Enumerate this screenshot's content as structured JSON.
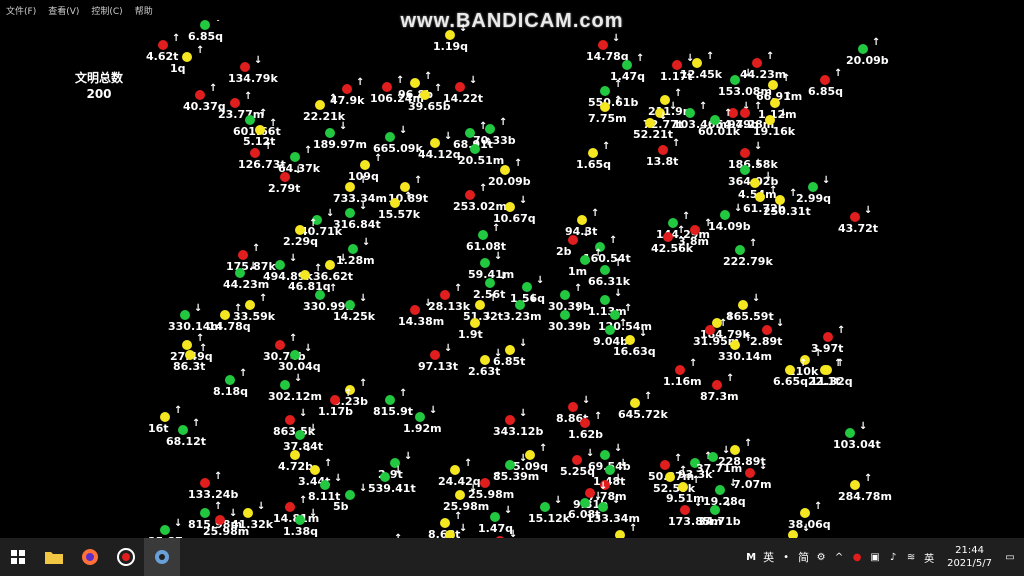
{
  "menu": [
    "文件(F)",
    "查看(V)",
    "控制(C)",
    "帮助"
  ],
  "watermark": "www.BANDICAM.com",
  "total": {
    "label": "文明总数",
    "value": "200"
  },
  "units": [
    {
      "c": "green",
      "v": "6.85q",
      "a": "↓"
    },
    {
      "c": "red",
      "v": "4.62t",
      "a": "↑"
    },
    {
      "c": "yellow",
      "v": "1q",
      "a": "↑"
    },
    {
      "c": "red",
      "v": "134.79k",
      "a": "↓"
    },
    {
      "c": "red",
      "v": "40.37q",
      "a": "↑"
    },
    {
      "c": "red",
      "v": "23.77m",
      "a": "↑"
    },
    {
      "c": "green",
      "v": "601.66t",
      "a": "↑"
    },
    {
      "c": "yellow",
      "v": "5.12t",
      "a": "↑"
    },
    {
      "c": "red",
      "v": "126.73t",
      "a": "↑"
    },
    {
      "c": "green",
      "v": "64.37k",
      "a": "↑"
    },
    {
      "c": "red",
      "v": "2.79t",
      "a": "↓"
    },
    {
      "c": "yellow",
      "v": "22.21k",
      "a": "↑"
    },
    {
      "c": "red",
      "v": "47.9k",
      "a": "↑"
    },
    {
      "c": "red",
      "v": "106.24m",
      "a": "↑"
    },
    {
      "c": "yellow",
      "v": "96.8b",
      "a": "↑"
    },
    {
      "c": "yellow",
      "v": "39.65b",
      "a": "↑"
    },
    {
      "c": "red",
      "v": "14.22t",
      "a": "↓"
    },
    {
      "c": "yellow",
      "v": "1.19q",
      "a": "↓"
    },
    {
      "c": "green",
      "v": "189.97m",
      "a": "↓"
    },
    {
      "c": "green",
      "v": "665.09k",
      "a": "↓"
    },
    {
      "c": "yellow",
      "v": "44.12q",
      "a": "↓"
    },
    {
      "c": "green",
      "v": "68.91t",
      "a": "↑"
    },
    {
      "c": "green",
      "v": "70.33b",
      "a": "↑"
    },
    {
      "c": "green",
      "v": "20.51m",
      "a": "↑"
    },
    {
      "c": "yellow",
      "v": "109q",
      "a": "↑"
    },
    {
      "c": "yellow",
      "v": "733.34m",
      "a": "↑"
    },
    {
      "c": "yellow",
      "v": "10.89t",
      "a": "↑"
    },
    {
      "c": "yellow",
      "v": "15.57k",
      "a": "↑"
    },
    {
      "c": "yellow",
      "v": "20.09b",
      "a": "↑"
    },
    {
      "c": "red",
      "v": "253.02m",
      "a": "↑"
    },
    {
      "c": "yellow",
      "v": "10.67q",
      "a": "↓"
    },
    {
      "c": "green",
      "v": "316.84t",
      "a": "↓"
    },
    {
      "c": "green",
      "v": "40.71k",
      "a": "↓"
    },
    {
      "c": "yellow",
      "v": "2.29q",
      "a": "↑"
    },
    {
      "c": "green",
      "v": "61.08t",
      "a": "↑"
    },
    {
      "c": "green",
      "v": "1.28m",
      "a": "↓"
    },
    {
      "c": "red",
      "v": "175.87k",
      "a": "↑"
    },
    {
      "c": "green",
      "v": "44.23m",
      "a": "↓"
    },
    {
      "c": "green",
      "v": "494.89k",
      "a": "↓"
    },
    {
      "c": "yellow",
      "v": "46.81q",
      "a": "↑"
    },
    {
      "c": "yellow",
      "v": "36.62t",
      "a": "↓"
    },
    {
      "c": "green",
      "v": "59.41m",
      "a": "↓"
    },
    {
      "c": "green",
      "v": "2.56t",
      "a": "↓"
    },
    {
      "c": "green",
      "v": "1.56q",
      "a": "↓"
    },
    {
      "c": "green",
      "v": "30.39b",
      "a": "↑"
    },
    {
      "c": "green",
      "v": "330.99k",
      "a": "↑"
    },
    {
      "c": "green",
      "v": "14.25k",
      "a": "↓"
    },
    {
      "c": "red",
      "v": "28.13k",
      "a": "↑"
    },
    {
      "c": "red",
      "v": "14.38m",
      "a": "↓"
    },
    {
      "c": "yellow",
      "v": "51.32t",
      "a": "↑"
    },
    {
      "c": "green",
      "v": "3.23m",
      "a": "↓"
    },
    {
      "c": "yellow",
      "v": "1.9t",
      "a": "↓"
    },
    {
      "c": "green",
      "v": "30.39b",
      "a": "↓"
    },
    {
      "c": "green",
      "v": "330.14m",
      "a": "↓"
    },
    {
      "c": "yellow",
      "v": "33.59k",
      "a": "↑"
    },
    {
      "c": "yellow",
      "v": "14.78q",
      "a": "↑"
    },
    {
      "c": "yellow",
      "v": "27.49q",
      "a": "↑"
    },
    {
      "c": "yellow",
      "v": "86.3t",
      "a": "↑"
    },
    {
      "c": "red",
      "v": "30.74b",
      "a": "↑"
    },
    {
      "c": "green",
      "v": "30.04q",
      "a": "↓"
    },
    {
      "c": "red",
      "v": "97.13t",
      "a": "↓"
    },
    {
      "c": "yellow",
      "v": "2.63t",
      "a": "↓"
    },
    {
      "c": "yellow",
      "v": "6.85t",
      "a": "↓"
    },
    {
      "c": "green",
      "v": "8.18q",
      "a": "↑"
    },
    {
      "c": "green",
      "v": "302.12m",
      "a": "↓"
    },
    {
      "c": "yellow",
      "v": "3.23b",
      "a": "↑"
    },
    {
      "c": "red",
      "v": "1.17b",
      "a": "↑"
    },
    {
      "c": "green",
      "v": "815.9t",
      "a": "↑"
    },
    {
      "c": "green",
      "v": "1.92m",
      "a": "↓"
    },
    {
      "c": "yellow",
      "v": "16t",
      "a": "↑"
    },
    {
      "c": "green",
      "v": "68.12t",
      "a": "↑"
    },
    {
      "c": "red",
      "v": "863.5k",
      "a": "↓"
    },
    {
      "c": "green",
      "v": "37.84t",
      "a": "↓"
    },
    {
      "c": "red",
      "v": "343.12b",
      "a": "↓"
    },
    {
      "c": "yellow",
      "v": "5.09q",
      "a": "↑"
    },
    {
      "c": "yellow",
      "v": "4.72b",
      "a": "↓"
    },
    {
      "c": "yellow",
      "v": "3.44t",
      "a": "↑"
    },
    {
      "c": "green",
      "v": "2.9t",
      "a": "↓"
    },
    {
      "c": "green",
      "v": "539.41t",
      "a": "↓"
    },
    {
      "c": "yellow",
      "v": "24.42q",
      "a": "↑"
    },
    {
      "c": "red",
      "v": "25.98m",
      "a": "↑"
    },
    {
      "c": "green",
      "v": "85.39m",
      "a": "↓"
    },
    {
      "c": "yellow",
      "v": "25.98m",
      "a": "↓"
    },
    {
      "c": "red",
      "v": "133.24b",
      "a": "↑"
    },
    {
      "c": "green",
      "v": "8.11t",
      "a": "↓"
    },
    {
      "c": "green",
      "v": "5b",
      "a": "↓"
    },
    {
      "c": "yellow",
      "v": "41.32k",
      "a": "↓"
    },
    {
      "c": "red",
      "v": "14.81m",
      "a": "↑"
    },
    {
      "c": "green",
      "v": "1.38q",
      "a": "↓"
    },
    {
      "c": "green",
      "v": "815.98m",
      "a": "↑"
    },
    {
      "c": "red",
      "v": "25.98m",
      "a": "↓"
    },
    {
      "c": "green",
      "v": "35.87q",
      "a": "↓"
    },
    {
      "c": "yellow",
      "v": "8.68t",
      "a": "↑"
    },
    {
      "c": "yellow",
      "v": "7.13q",
      "a": "↓"
    },
    {
      "c": "green",
      "v": "1.47q",
      "a": "↓"
    },
    {
      "c": "red",
      "v": "46.81q",
      "a": "↑"
    },
    {
      "c": "red",
      "v": "70.38t",
      "a": "↓"
    },
    {
      "c": "green",
      "v": "15.12k",
      "a": "↓"
    },
    {
      "c": "red",
      "v": "17.61m",
      "a": "↑"
    },
    {
      "c": "red",
      "v": "14.78q",
      "a": "↓"
    },
    {
      "c": "green",
      "v": "1.47q",
      "a": "↑"
    },
    {
      "c": "red",
      "v": "1.17t",
      "a": "↓"
    },
    {
      "c": "yellow",
      "v": "12.45k",
      "a": "↑"
    },
    {
      "c": "red",
      "v": "44.23m",
      "a": "↑"
    },
    {
      "c": "green",
      "v": "550.61b",
      "a": "↑"
    },
    {
      "c": "yellow",
      "v": "7.75m",
      "a": "↑"
    },
    {
      "c": "green",
      "v": "153.08m",
      "a": "↓"
    },
    {
      "c": "yellow",
      "v": "66.91m",
      "a": "↑"
    },
    {
      "c": "red",
      "v": "6.85q",
      "a": "↑"
    },
    {
      "c": "green",
      "v": "20.09b",
      "a": "↑"
    },
    {
      "c": "yellow",
      "v": "1.12m",
      "a": "↑"
    },
    {
      "c": "yellow",
      "v": "211.9m",
      "a": "↑"
    },
    {
      "c": "yellow",
      "v": "72.77t",
      "a": "↓"
    },
    {
      "c": "green",
      "v": "103.46m",
      "a": "↑"
    },
    {
      "c": "red",
      "v": "54.79b",
      "a": "↓"
    },
    {
      "c": "red",
      "v": "94.28m",
      "a": "↑"
    },
    {
      "c": "green",
      "v": "60.01k",
      "a": "↑"
    },
    {
      "c": "yellow",
      "v": "52.21t",
      "a": "↓"
    },
    {
      "c": "yellow",
      "v": "19.16k",
      "a": "↓"
    },
    {
      "c": "yellow",
      "v": "1.65q",
      "a": "↑"
    },
    {
      "c": "red",
      "v": "13.8t",
      "a": "↑"
    },
    {
      "c": "red",
      "v": "186.58k",
      "a": "↓"
    },
    {
      "c": "green",
      "v": "364.02b",
      "a": "↓"
    },
    {
      "c": "yellow",
      "v": "4.54m",
      "a": "↓"
    },
    {
      "c": "yellow",
      "v": "61.72b",
      "a": "↑"
    },
    {
      "c": "yellow",
      "v": "250.31t",
      "a": "↑"
    },
    {
      "c": "green",
      "v": "2.99q",
      "a": "↓"
    },
    {
      "c": "red",
      "v": "43.72t",
      "a": "↓"
    },
    {
      "c": "yellow",
      "v": "94.3t",
      "a": "↑"
    },
    {
      "c": "red",
      "v": "2b",
      "a": "↓"
    },
    {
      "c": "green",
      "v": "160.54t",
      "a": "↑"
    },
    {
      "c": "green",
      "v": "1m",
      "a": "↑"
    },
    {
      "c": "green",
      "v": "66.31k",
      "a": "↑"
    },
    {
      "c": "green",
      "v": "144.29m",
      "a": "↑"
    },
    {
      "c": "red",
      "v": "42.56k",
      "a": "↑"
    },
    {
      "c": "red",
      "v": "3.8m",
      "a": "↑"
    },
    {
      "c": "green",
      "v": "14.09b",
      "a": "↓"
    },
    {
      "c": "green",
      "v": "222.79k",
      "a": "↑"
    },
    {
      "c": "green",
      "v": "1.13m",
      "a": "↓"
    },
    {
      "c": "green",
      "v": "120.54m",
      "a": "↑"
    },
    {
      "c": "green",
      "v": "9.04b",
      "a": "↑"
    },
    {
      "c": "yellow",
      "v": "16.63q",
      "a": "↓"
    },
    {
      "c": "yellow",
      "v": "865.59t",
      "a": "↓"
    },
    {
      "c": "yellow",
      "v": "184.79k",
      "a": "↑"
    },
    {
      "c": "red",
      "v": "31.95m",
      "a": "↑"
    },
    {
      "c": "red",
      "v": "2.89t",
      "a": "↓"
    },
    {
      "c": "yellow",
      "v": "330.14m",
      "a": "↑"
    },
    {
      "c": "red",
      "v": "3.97t",
      "a": "↑"
    },
    {
      "c": "yellow",
      "v": "210k",
      "a": "↑"
    },
    {
      "c": "yellow",
      "v": "22.1t",
      "a": "↑"
    },
    {
      "c": "red",
      "v": "1.16m",
      "a": "↑"
    },
    {
      "c": "red",
      "v": "87.3m",
      "a": "↑"
    },
    {
      "c": "yellow",
      "v": "6.65q",
      "a": "↑"
    },
    {
      "c": "yellow",
      "v": "11.32q",
      "a": "↑"
    },
    {
      "c": "yellow",
      "v": "645.72k",
      "a": "↑"
    },
    {
      "c": "red",
      "v": "8.86t",
      "a": "↓"
    },
    {
      "c": "red",
      "v": "1.62b",
      "a": "↑"
    },
    {
      "c": "green",
      "v": "103.04t",
      "a": "↓"
    },
    {
      "c": "green",
      "v": "69.54b",
      "a": "↓"
    },
    {
      "c": "red",
      "v": "5.25q",
      "a": "↓"
    },
    {
      "c": "green",
      "v": "1.48t",
      "a": "↓"
    },
    {
      "c": "red",
      "v": "7.78m",
      "a": "↓"
    },
    {
      "c": "red",
      "v": "9.31b",
      "a": "↓"
    },
    {
      "c": "green",
      "v": "6.08t",
      "a": "↓"
    },
    {
      "c": "green",
      "v": "133.34m",
      "a": "↓"
    },
    {
      "c": "red",
      "v": "50.27m",
      "a": "↑"
    },
    {
      "c": "yellow",
      "v": "52.59k",
      "a": "↑"
    },
    {
      "c": "green",
      "v": "93.3k",
      "a": "↑"
    },
    {
      "c": "yellow",
      "v": "228.89t",
      "a": "↑"
    },
    {
      "c": "green",
      "v": "37.71m",
      "a": "↓"
    },
    {
      "c": "red",
      "v": "7.07m",
      "a": "↓"
    },
    {
      "c": "yellow",
      "v": "9.51m",
      "a": "↑"
    },
    {
      "c": "green",
      "v": "19.28q",
      "a": "↓"
    },
    {
      "c": "yellow",
      "v": "284.78m",
      "a": "↑"
    },
    {
      "c": "red",
      "v": "173.85m",
      "a": "↓"
    },
    {
      "c": "green",
      "v": "34.71b",
      "a": "↓"
    },
    {
      "c": "yellow",
      "v": "38.06q",
      "a": "↑"
    },
    {
      "c": "yellow",
      "v": "108.59b",
      "a": "↓"
    },
    {
      "c": "yellow",
      "v": "95.67b",
      "a": "↑"
    },
    {
      "c": "green",
      "v": "1.32t",
      "a": "↑"
    },
    {
      "c": "yellow",
      "v": "6.62t",
      "a": "↑"
    }
  ],
  "taskbar": {
    "clock_time": "21:44",
    "clock_date": "2021/5/7",
    "ime_label": "英",
    "ime_mode": "简"
  }
}
